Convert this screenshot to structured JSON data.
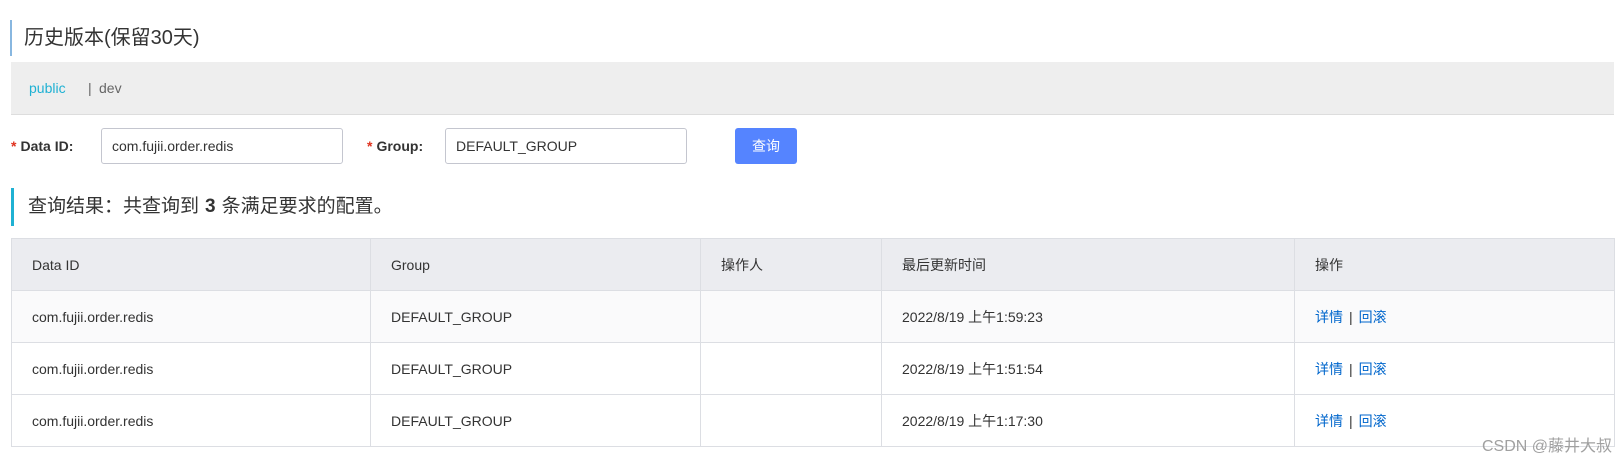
{
  "page": {
    "title": "历史版本(保留30天)"
  },
  "namespaces": {
    "active": "public",
    "separator": "|",
    "other": "dev"
  },
  "form": {
    "data_id_label": "Data ID:",
    "data_id_value": "com.fujii.order.redis",
    "group_label": "Group:",
    "group_value": "DEFAULT_GROUP",
    "required_mark": "*",
    "query_button": "查询"
  },
  "result": {
    "prefix": "查询结果：共查询到",
    "count": "3",
    "suffix": "条满足要求的配置。"
  },
  "table": {
    "headers": [
      "Data ID",
      "Group",
      "操作人",
      "最后更新时间",
      "操作"
    ],
    "rows": [
      {
        "data_id": "com.fujii.order.redis",
        "group": "DEFAULT_GROUP",
        "operator": "",
        "updated": "2022/8/19 上午1:59:23",
        "detail": "详情",
        "sep": "|",
        "rollback": "回滚"
      },
      {
        "data_id": "com.fujii.order.redis",
        "group": "DEFAULT_GROUP",
        "operator": "",
        "updated": "2022/8/19 上午1:51:54",
        "detail": "详情",
        "sep": "|",
        "rollback": "回滚"
      },
      {
        "data_id": "com.fujii.order.redis",
        "group": "DEFAULT_GROUP",
        "operator": "",
        "updated": "2022/8/19 上午1:17:30",
        "detail": "详情",
        "sep": "|",
        "rollback": "回滚"
      }
    ]
  },
  "watermark": "CSDN @藤井大叔",
  "colors": {
    "accent": "#1fb1d3",
    "button": "#5584ff",
    "link": "#0066cc",
    "required": "#e0321e"
  }
}
